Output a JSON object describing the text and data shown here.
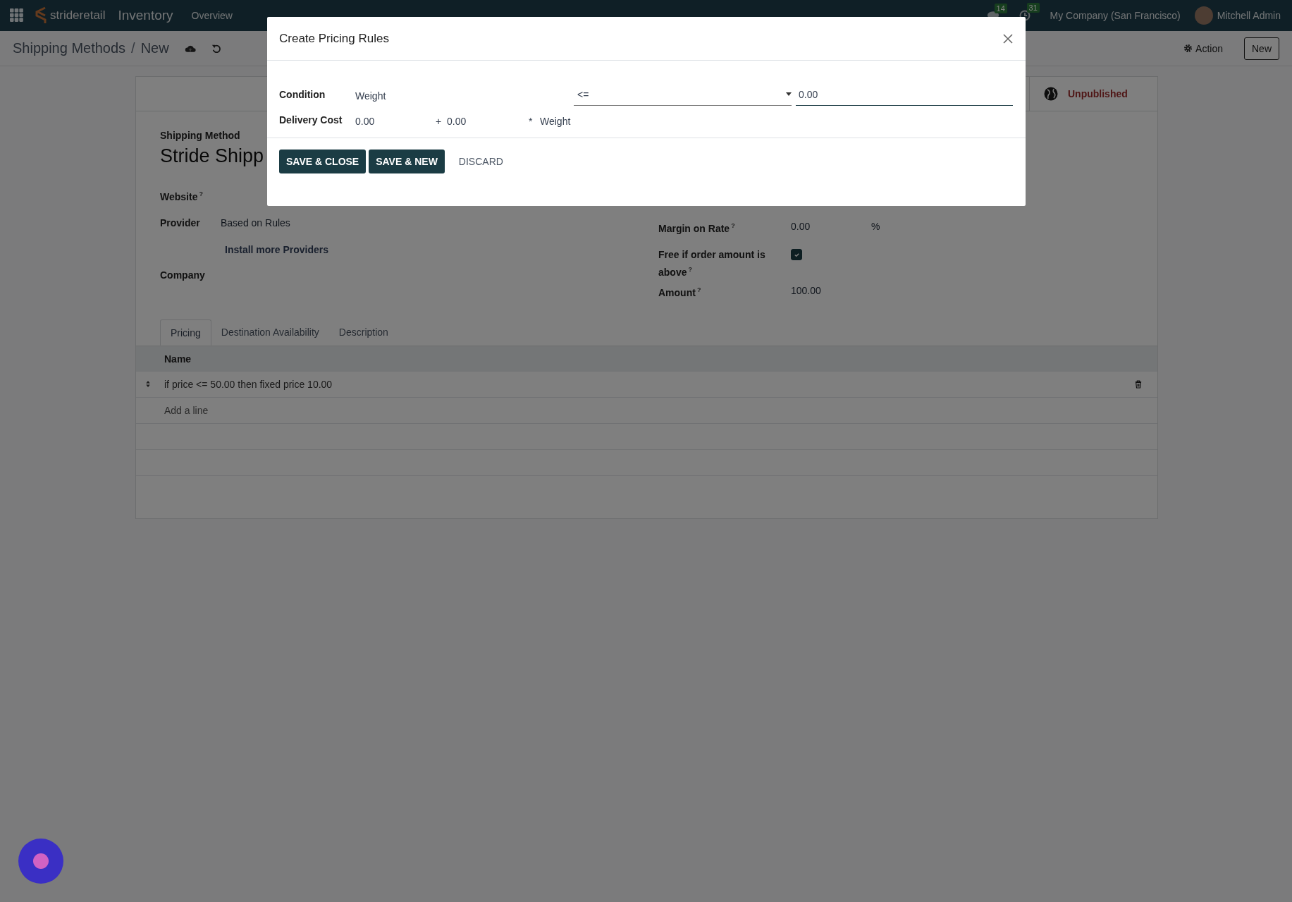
{
  "navbar": {
    "logo": "**stride**retail",
    "app_name": "Inventory",
    "menu": [
      "Overview"
    ],
    "messages_badge": "14",
    "activities_badge": "31",
    "company": "My Company (San Francisco)",
    "user": "Mitchell Admin"
  },
  "control_panel": {
    "breadcrumb": [
      "Shipping Methods",
      "New"
    ],
    "separator": "/",
    "action": "Action",
    "new_button": "New"
  },
  "sheet": {
    "status_button": "Unpublished",
    "title_label": "Shipping Method",
    "title": "Stride Shipp",
    "left_fields": [
      {
        "label": "Website",
        "help": "?",
        "kind": "empty"
      },
      {
        "label": "Provider",
        "kind": "text",
        "value": "Based on Rules",
        "link": "Install more Providers"
      },
      {
        "label": "Company",
        "kind": "empty"
      }
    ],
    "right_fields": [
      {
        "label": "Margin on Rate",
        "help": "?",
        "kind": "text",
        "value": "0.00",
        "suffix": "%"
      },
      {
        "label": "Free if order amount is above",
        "help": "?",
        "kind": "checkbox",
        "checked": true
      },
      {
        "label": "Amount",
        "help": "?",
        "kind": "text",
        "value": "100.00"
      }
    ],
    "tabs": [
      {
        "label": "Pricing",
        "selected": true
      },
      {
        "label": "Destination Availability",
        "selected": false
      },
      {
        "label": "Description",
        "selected": false
      }
    ],
    "table": {
      "columns": [
        "Name"
      ],
      "rows": [
        {
          "name": "if price <= 50.00 then fixed price 10.00"
        }
      ],
      "add_line": "Add a line"
    }
  },
  "dialog": {
    "title": "Create Pricing Rules",
    "condition": {
      "label": "Condition",
      "variable": "Weight",
      "operator": "<=",
      "value": "0.00"
    },
    "delivery_cost": {
      "label": "Delivery Cost",
      "fixed": "0.00",
      "plus": "+",
      "variable_factor": "0.00",
      "times": "*",
      "variable": "Weight"
    },
    "buttons": [
      {
        "label": "SAVE & CLOSE",
        "kind": "primary"
      },
      {
        "label": "SAVE & NEW",
        "kind": "primary"
      },
      {
        "label": "DISCARD",
        "kind": "link"
      }
    ]
  }
}
